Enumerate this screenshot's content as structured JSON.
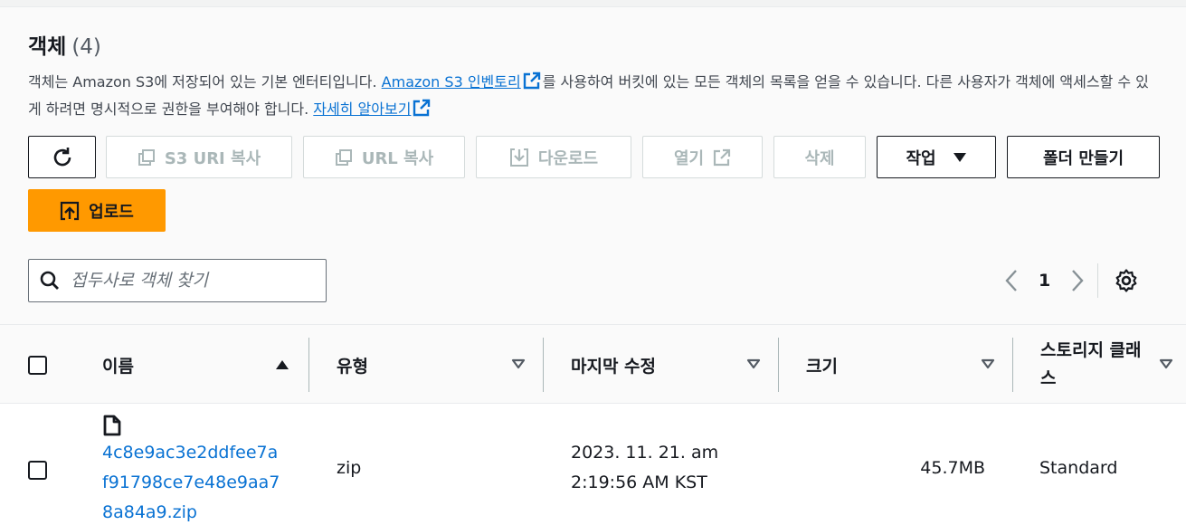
{
  "header": {
    "title": "객체",
    "count": "(4)"
  },
  "description": {
    "part1": "객체는 Amazon S3에 저장되어 있는 기본 엔터티입니다. ",
    "link1": "Amazon S3 인벤토리",
    "part2": "를 사용하여 버킷에 있는 모든 객체의 목록을 얻을 수 있습니다. 다른 사용자가 객체에 액세스할 수 있게 하려면 명시적으로 권한을 부여해야 합니다. ",
    "link2": "자세히 알아보기"
  },
  "toolbar": {
    "copy_s3_uri": "S3 URI 복사",
    "copy_url": "URL 복사",
    "download": "다운로드",
    "open": "열기",
    "delete": "삭제",
    "actions": "작업",
    "create_folder": "폴더 만들기",
    "upload": "업로드"
  },
  "search": {
    "placeholder": "접두사로 객체 찾기",
    "value": ""
  },
  "pagination": {
    "current_page": "1"
  },
  "table": {
    "columns": [
      "이름",
      "유형",
      "마지막 수정",
      "크기",
      "스토리지 클래스"
    ],
    "rows": [
      {
        "name_line1": "4c8e9ac3e2ddfee7a",
        "name_line2": "f91798ce7e48e9aa7",
        "name_line3": "8a84a9.zip",
        "type": "zip",
        "modified_line1": "2023. 11. 21. am",
        "modified_line2": "2:19:56 AM KST",
        "size": "45.7MB",
        "storage_class": "Standard"
      }
    ]
  },
  "icons": [
    "refresh-icon",
    "copy-icon",
    "download-icon",
    "external-link-icon",
    "caret-down-icon",
    "upload-icon",
    "search-icon",
    "chevron-left-icon",
    "chevron-right-icon",
    "settings-icon",
    "sort-up-icon",
    "sort-down-icon",
    "file-icon"
  ],
  "colors": {
    "link": "#0972d3",
    "primary_button": "#ff9900",
    "text": "#16191f",
    "disabled_text": "#aab7b8"
  }
}
